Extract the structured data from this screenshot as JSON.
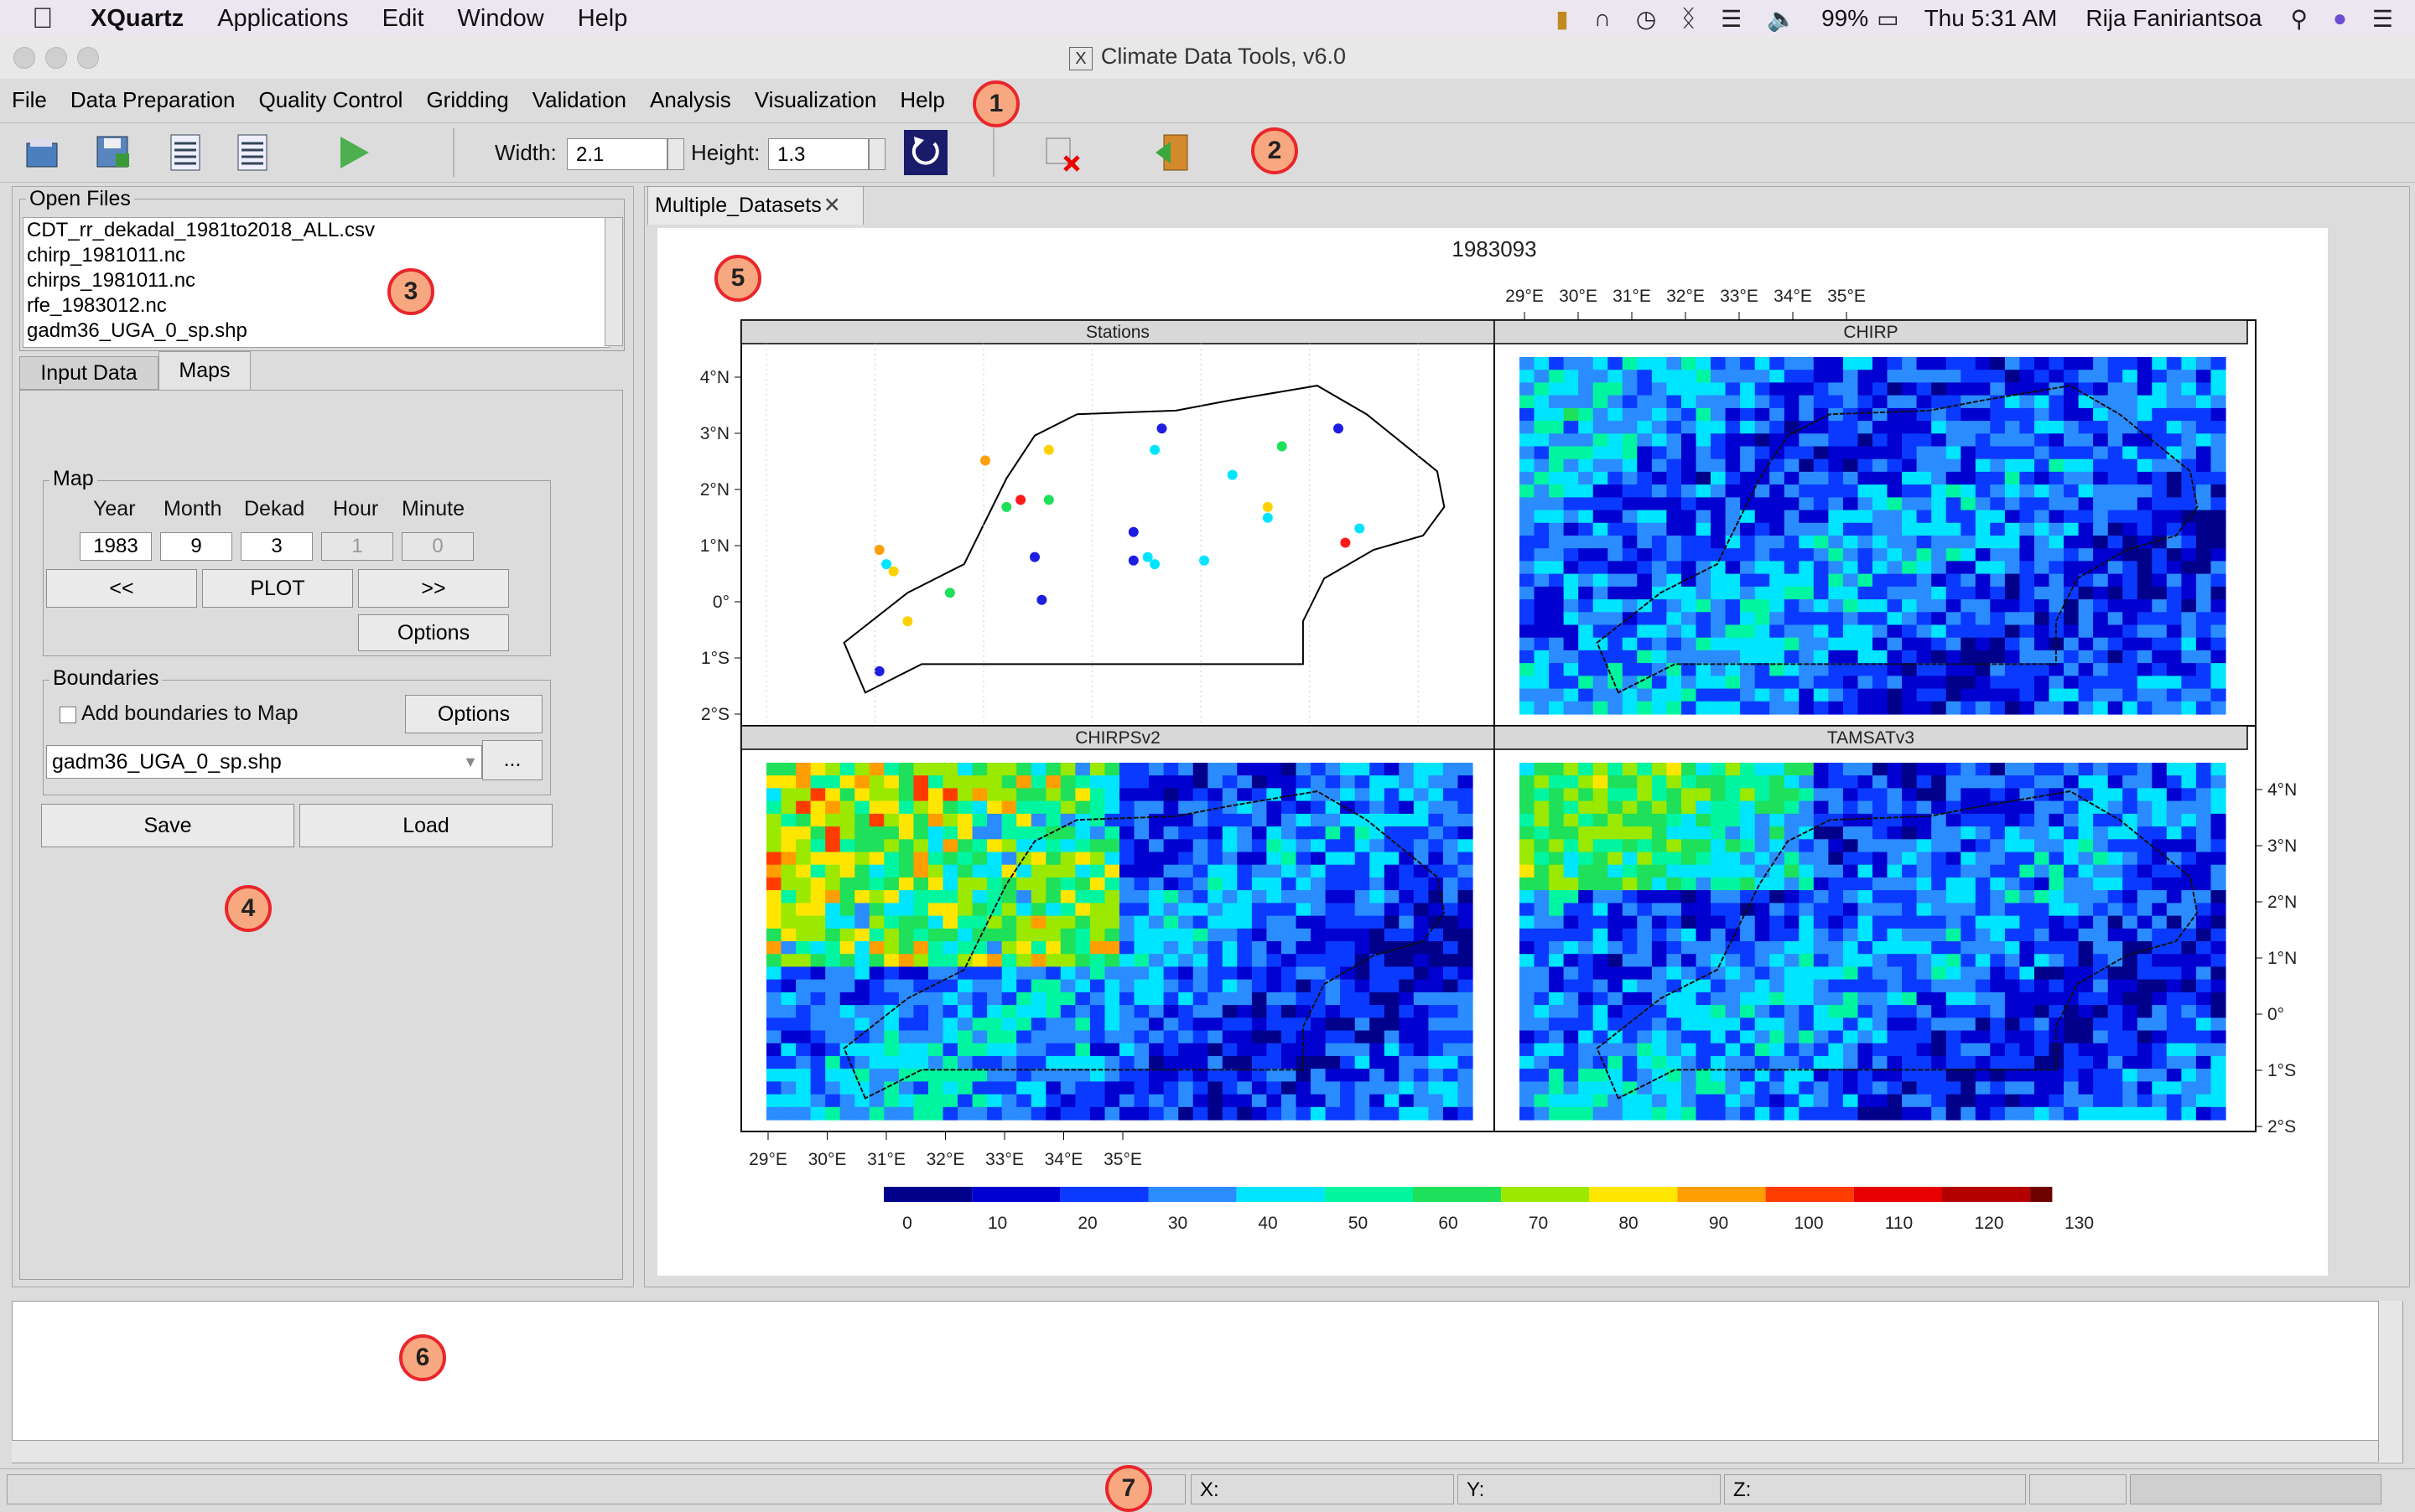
{
  "mac_menubar": {
    "app_name": "XQuartz",
    "items": [
      "Applications",
      "Edit",
      "Window",
      "Help"
    ],
    "battery": "99%",
    "datetime": "Thu 5:31 AM",
    "user": "Rija Faniriantsoa"
  },
  "window": {
    "title": "Climate Data Tools, v6.0"
  },
  "app_menu": [
    "File",
    "Data Preparation",
    "Quality Control",
    "Gridding",
    "Validation",
    "Analysis",
    "Visualization",
    "Help"
  ],
  "toolbar": {
    "width_label": "Width:",
    "width_value": "2.1",
    "height_label": "Height:",
    "height_value": "1.3"
  },
  "open_files": {
    "title": "Open Files",
    "files": [
      "CDT_rr_dekadal_1981to2018_ALL.csv",
      "chirp_1981011.nc",
      "chirps_1981011.nc",
      "rfe_1983012.nc",
      "gadm36_UGA_0_sp.shp"
    ]
  },
  "tabs": [
    "Input Data",
    "Maps"
  ],
  "map_panel": {
    "title": "Map",
    "col_labels": [
      "Year",
      "Month",
      "Dekad",
      "Hour",
      "Minute"
    ],
    "values": [
      "1983",
      "9",
      "3",
      "1",
      "0"
    ],
    "prev_label": "<<",
    "plot_label": "PLOT",
    "next_label": ">>",
    "options_label": "Options"
  },
  "boundaries": {
    "title": "Boundaries",
    "checkbox_label": "Add boundaries to Map",
    "options_label": "Options",
    "shapefile": "gadm36_UGA_0_sp.shp",
    "browse_label": "..."
  },
  "save_label": "Save",
  "load_label": "Load",
  "plot_tab": "Multiple_Datasets",
  "plot": {
    "title": "1983093",
    "panels": [
      "Stations",
      "CHIRP",
      "CHIRPSv2",
      "TAMSATv3"
    ],
    "x_ticks": [
      "29°E",
      "30°E",
      "31°E",
      "32°E",
      "33°E",
      "34°E",
      "35°E"
    ],
    "y_ticks": [
      "4°N",
      "3°N",
      "2°N",
      "1°N",
      "0°",
      "1°S",
      "2°S"
    ],
    "colorbar_labels": [
      "0",
      "10",
      "20",
      "30",
      "40",
      "50",
      "60",
      "70",
      "80",
      "90",
      "100",
      "110",
      "120",
      "130"
    ],
    "colorbar_colors": [
      "#00008b",
      "#0000d0",
      "#0a3aff",
      "#2b8cff",
      "#00e5ff",
      "#00f5a0",
      "#1ee05a",
      "#9be800",
      "#ffe600",
      "#ff9e00",
      "#ff3c00",
      "#e60000",
      "#b40000",
      "#6e0000"
    ]
  },
  "status": {
    "x_label": "X:",
    "y_label": "Y:",
    "z_label": "Z:"
  },
  "callouts": [
    "1",
    "2",
    "3",
    "4",
    "5",
    "6",
    "7"
  ]
}
